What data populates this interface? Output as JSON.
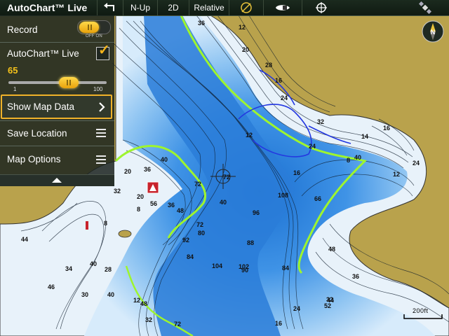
{
  "app": {
    "title": "AutoChart™ Live"
  },
  "toolbar": {
    "back_icon": "return-arrow-icon",
    "orientation_label": "N-Up",
    "view_label": "2D",
    "mode_label": "Relative",
    "gps_icon": "satellite-dish-icon",
    "boat_icon": "boat-icon",
    "crosshair_icon": "crosshair-icon",
    "satellite_icon": "satellite-status-icon"
  },
  "panel": {
    "record": {
      "label": "Record",
      "toggle_off": "OFF",
      "toggle_on": "ON",
      "state": "on"
    },
    "autochart_live": {
      "label": "AutoChart™ Live",
      "checked": true
    },
    "sensitivity": {
      "value": "65",
      "min": "1",
      "max": "100",
      "fraction": 0.65
    },
    "show_map_data": {
      "label": "Show Map Data",
      "icon": "chevron-right-icon"
    },
    "save_location": {
      "label": "Save Location",
      "icon": "menu-lines-icon"
    },
    "map_options": {
      "label": "Map Options",
      "icon": "menu-lines-icon"
    },
    "collapse_icon": "chevron-up-icon"
  },
  "map": {
    "north_label": "N",
    "scale_label": "200ft",
    "depths": [
      "36",
      "12",
      "20",
      "28",
      "16",
      "24",
      "40",
      "12",
      "32",
      "24",
      "16",
      "16",
      "14",
      "24",
      "12",
      "8",
      "40",
      "36",
      "32",
      "20",
      "8",
      "20",
      "56",
      "36",
      "72",
      "72",
      "40",
      "48",
      "8",
      "72",
      "80",
      "92",
      "108",
      "96",
      "84",
      "88",
      "104",
      "102",
      "90",
      "84",
      "66",
      "48",
      "44",
      "52",
      "32",
      "36",
      "24",
      "16",
      "44",
      "46",
      "30",
      "40",
      "28",
      "34",
      "40",
      "48",
      "32",
      "12",
      "72"
    ],
    "colors": {
      "land": "#b9a24c",
      "shallow": "#e9f3fb",
      "deep": "#1e78d4",
      "contour_highlight": "#9ef52e"
    }
  }
}
